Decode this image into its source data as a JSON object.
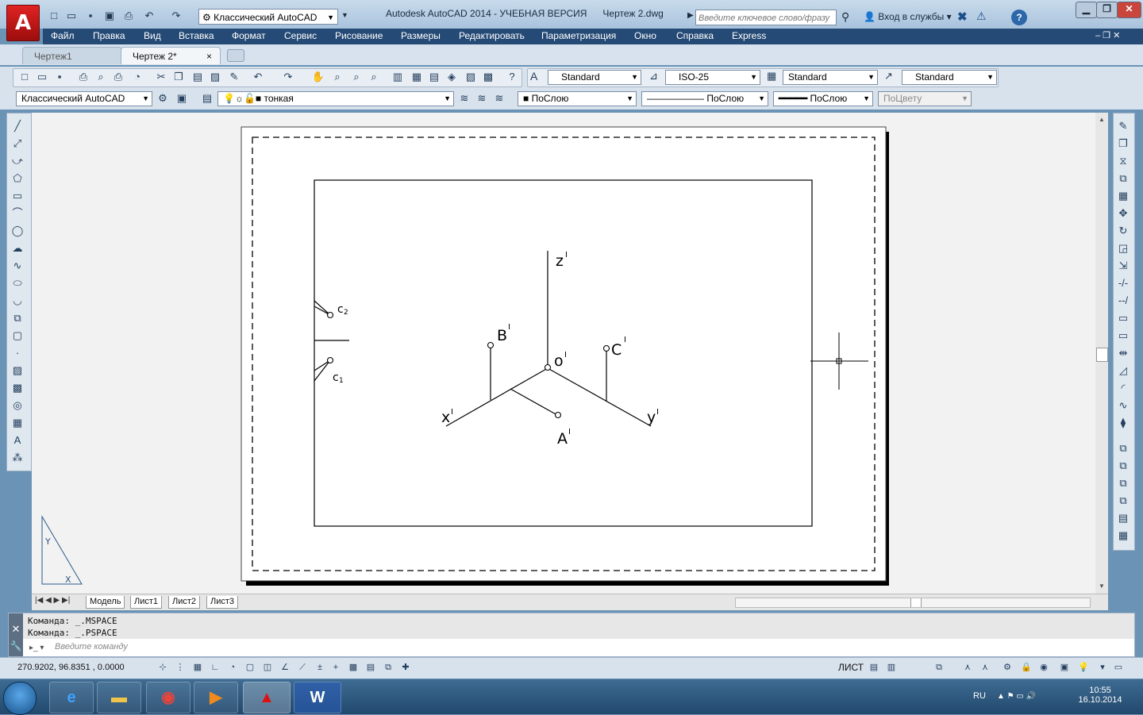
{
  "app": {
    "title": "Autodesk AutoCAD 2014 - УЧЕБНАЯ ВЕРСИЯ      Чертеж 2.dwg",
    "workspace": "Классический AutoCAD",
    "search_placeholder": "Введите ключевое слово/фразу",
    "signin": "Вход в службы",
    "logo": "A"
  },
  "menu": [
    "Файл",
    "Правка",
    "Вид",
    "Вставка",
    "Формат",
    "Сервис",
    "Рисование",
    "Размеры",
    "Редактировать",
    "Параметризация",
    "Окно",
    "Справка",
    "Express"
  ],
  "doc_tabs": [
    {
      "label": "Чертеж1",
      "close": "×"
    },
    {
      "label": "Чертеж 2*",
      "close": "×"
    }
  ],
  "toolbar": {
    "text_style": "Standard",
    "dim_style": "ISO-25",
    "table_style": "Standard",
    "mleader_style": "Standard",
    "workspace2": "Классический AutoCAD",
    "layer": "тонкая",
    "color": "ПоСлою",
    "linetype": "ПоСлою",
    "lineweight": "ПоСлою",
    "plotstyle": "ПоЦвету"
  },
  "drawing": {
    "labels": {
      "z": "z",
      "z_sup": "I",
      "x": "x",
      "x_sup": "I",
      "y": "y",
      "y_sup": "I",
      "o": "o",
      "o_sup": "I",
      "A": "A",
      "A_sup": "I",
      "B": "B",
      "B_sup": "I",
      "C": "C",
      "C_sup": "I",
      "c2": "c",
      "c2_sub": "2",
      "c1": "c",
      "c1_sub": "1",
      "ucs_x": "X",
      "ucs_y": "Y"
    }
  },
  "layout_tabs": [
    "Модель",
    "Лист1",
    "Лист2",
    "Лист3"
  ],
  "command": {
    "history": [
      "Команда:  _.MSPACE",
      "Команда:  _.PSPACE"
    ],
    "placeholder": "Введите команду"
  },
  "status": {
    "coords": "270.9202,  96.8351  , 0.0000",
    "space": "ЛИСТ"
  },
  "taskbar": {
    "lang": "RU",
    "time": "10:55",
    "date": "16.10.2014"
  }
}
